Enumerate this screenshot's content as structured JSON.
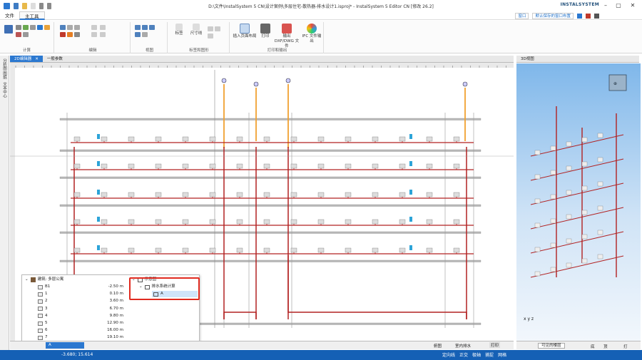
{
  "window": {
    "title": "D:\\文件\\InstalSystem 5 CN\\设计案例\\多层住宅-散热器-排水设计1.isproj* - InstalSystem 5 Editor CN [修改 26.2]",
    "brand": "INSTALSYSTEM",
    "min_icon": "minimize-icon",
    "max_icon": "maximize-icon",
    "close_icon": "close-icon"
  },
  "menu": {
    "items": [
      "文件",
      "主工具"
    ],
    "window_dropdown": "窗口",
    "layout_dropdown": "默认保存的窗口布置"
  },
  "ribbon": {
    "groups": [
      "计算",
      "编辑",
      "视图",
      "标签和图形",
      "打印和输出"
    ],
    "edit_small_labels": [
      "标签",
      "尺寸线"
    ],
    "print_buttons": [
      "插入页面布局",
      "打印",
      "输出 DXF/DWG 文件",
      "IFC 文件输出"
    ]
  },
  "tabs": {
    "main": [
      "2D编辑器",
      "一般参数"
    ],
    "view3d": "3D视图"
  },
  "left_strip": [
    "分析图 图纸",
    "文本中心"
  ],
  "floors_panel": {
    "root": "建筑: 多层公寓",
    "levels": [
      {
        "name": "B1",
        "height": "-2.50 m"
      },
      {
        "name": "1",
        "height": "0.10 m"
      },
      {
        "name": "2",
        "height": "3.60 m"
      },
      {
        "name": "3",
        "height": "6.70 m"
      },
      {
        "name": "4",
        "height": "9.80 m"
      },
      {
        "name": "5",
        "height": "12.90 m"
      },
      {
        "name": "6",
        "height": "16.00 m"
      },
      {
        "name": "7",
        "height": "19.10 m"
      }
    ]
  },
  "diagram_tree": {
    "root": "示意图",
    "child": "排水系统计算",
    "leaf": "A"
  },
  "bottom_bar": {
    "selected_level": "A",
    "items": [
      "俯图",
      "室内排水",
      "打印"
    ],
    "view3d_level": "可见的楼层",
    "view3d_items": [
      "底",
      "顶",
      "打"
    ]
  },
  "status": {
    "coords": "-3.680; 15.614",
    "right_items": [
      "定向线",
      "正交",
      "极轴",
      "捕捉",
      "网格"
    ]
  },
  "colors": {
    "accent": "#2b78d0",
    "status": "#1560b5",
    "pipe_red": "#b22222",
    "pipe_orange": "#f0a030",
    "highlight": "#e02a1f"
  }
}
